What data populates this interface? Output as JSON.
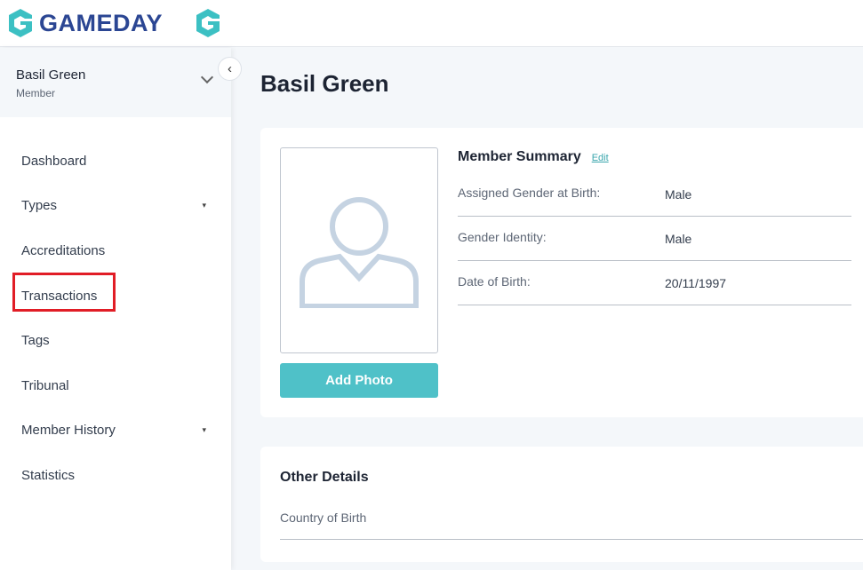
{
  "brand": {
    "name": "GAMEDAY",
    "logo_color": "#2b4693",
    "icon_color": "#3cc0c3"
  },
  "user": {
    "name": "Basil Green",
    "role": "Member"
  },
  "nav": [
    {
      "label": "Dashboard"
    },
    {
      "label": "Types",
      "caret": "▾"
    },
    {
      "label": "Accreditations"
    },
    {
      "label": "Transactions",
      "highlighted": true
    },
    {
      "label": "Tags"
    },
    {
      "label": "Tribunal"
    },
    {
      "label": "Member History",
      "caret": "▾"
    },
    {
      "label": "Statistics"
    }
  ],
  "page": {
    "title": "Basil Green"
  },
  "summary": {
    "title": "Member Summary",
    "edit": "Edit",
    "add_photo": "Add Photo",
    "rows": [
      {
        "label": "Assigned Gender at Birth:",
        "value": "Male"
      },
      {
        "label": "Gender Identity:",
        "value": "Male"
      },
      {
        "label": "Date of Birth:",
        "value": "20/11/1997"
      }
    ]
  },
  "other": {
    "title": "Other Details",
    "rows": [
      {
        "label": "Country of Birth"
      }
    ]
  }
}
